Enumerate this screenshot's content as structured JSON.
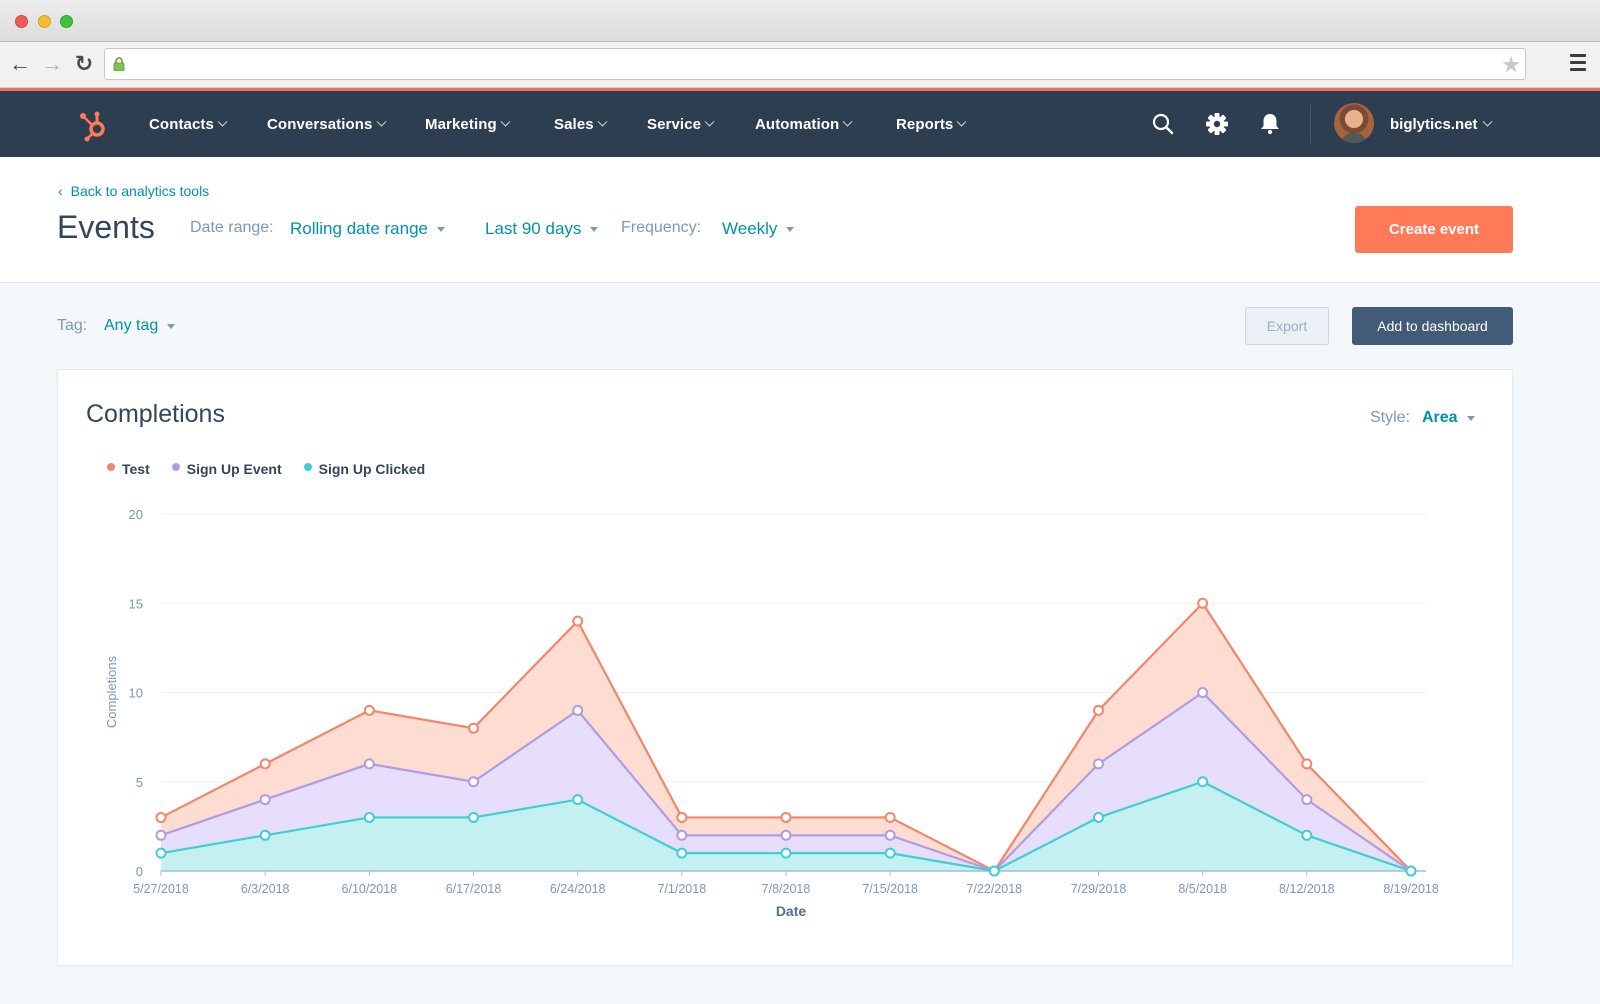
{
  "browser": {
    "url": "",
    "icons": {
      "back": "arrow-left-icon",
      "forward": "arrow-right-icon",
      "reload": "reload-icon",
      "lock": "lock-icon",
      "bookmark": "star-icon",
      "menu": "hamburger-menu-icon"
    }
  },
  "appnav": {
    "items": [
      {
        "label": "Contacts"
      },
      {
        "label": "Conversations"
      },
      {
        "label": "Marketing"
      },
      {
        "label": "Sales"
      },
      {
        "label": "Service"
      },
      {
        "label": "Automation"
      },
      {
        "label": "Reports"
      }
    ],
    "account": "biglytics.net",
    "colors": {
      "bar": "#2d3e50",
      "accent": "#f2705d",
      "logo": "#ff7a59"
    }
  },
  "header": {
    "back_link": "Back to analytics tools",
    "title": "Events",
    "date_range_label": "Date range:",
    "date_range_value": "Rolling date range",
    "period_value": "Last 90 days",
    "frequency_label": "Frequency:",
    "frequency_value": "Weekly",
    "create_button": "Create event"
  },
  "subbar": {
    "tag_label": "Tag:",
    "tag_value": "Any tag",
    "export_button": "Export",
    "dashboard_button": "Add to dashboard"
  },
  "card": {
    "title": "Completions",
    "style_label": "Style:",
    "style_value": "Area"
  },
  "chart_data": {
    "type": "area",
    "stacked": true,
    "title": "Completions",
    "xlabel": "Date",
    "ylabel": "Completions",
    "ylim": [
      0,
      20
    ],
    "yticks": [
      0,
      5,
      10,
      15,
      20
    ],
    "grid": true,
    "legend_position": "top-left",
    "categories": [
      "5/27/2018",
      "6/3/2018",
      "6/10/2018",
      "6/17/2018",
      "6/24/2018",
      "7/1/2018",
      "7/8/2018",
      "7/15/2018",
      "7/22/2018",
      "7/29/2018",
      "8/5/2018",
      "8/12/2018",
      "8/19/2018"
    ],
    "series": [
      {
        "name": "Test",
        "color": "#f2866b",
        "fill": "#fddcd2",
        "values": [
          1,
          2,
          3,
          3,
          5,
          1,
          1,
          1,
          0,
          3,
          5,
          2,
          0
        ]
      },
      {
        "name": "Sign Up Event",
        "color": "#b09be6",
        "fill": "#e6defa",
        "values": [
          1,
          2,
          3,
          2,
          5,
          1,
          1,
          1,
          0,
          3,
          5,
          2,
          0
        ]
      },
      {
        "name": "Sign Up Clicked",
        "color": "#3ecfd5",
        "fill": "#c4f0f2",
        "values": [
          1,
          2,
          3,
          3,
          4,
          1,
          1,
          1,
          0,
          3,
          5,
          2,
          0
        ]
      }
    ]
  }
}
